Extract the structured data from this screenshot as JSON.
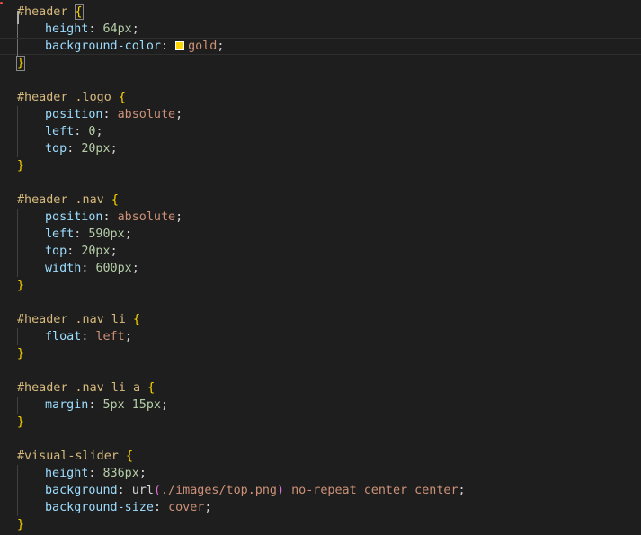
{
  "colors": {
    "background": "#1e1e1e",
    "selector": "#d7ba7d",
    "property": "#9cdcfe",
    "number": "#b5cea8",
    "keyword": "#ce9178",
    "brace": "#ffd700",
    "paren": "#da70d6",
    "swatch_gold": "#ffd700"
  },
  "lines": [
    {
      "tokens": [
        {
          "t": "#header ",
          "c": "sel"
        },
        {
          "t": "{",
          "c": "brace matched"
        }
      ]
    },
    {
      "indent": true,
      "tokens": [
        {
          "t": "height",
          "c": "prop"
        },
        {
          "t": ": ",
          "c": "punct"
        },
        {
          "t": "64px",
          "c": "num"
        },
        {
          "t": ";",
          "c": "punct"
        }
      ]
    },
    {
      "indent": true,
      "current": true,
      "tokens": [
        {
          "t": "background-color",
          "c": "prop"
        },
        {
          "t": ": ",
          "c": "punct"
        },
        {
          "swatch": "#ffd700"
        },
        {
          "t": "gold",
          "c": "kw"
        },
        {
          "t": ";",
          "c": "punct"
        }
      ]
    },
    {
      "tokens": [
        {
          "t": "}",
          "c": "brace matched"
        }
      ]
    },
    {
      "tokens": []
    },
    {
      "tokens": [
        {
          "t": "#header .logo ",
          "c": "sel"
        },
        {
          "t": "{",
          "c": "brace"
        }
      ]
    },
    {
      "indent": true,
      "tokens": [
        {
          "t": "position",
          "c": "prop"
        },
        {
          "t": ": ",
          "c": "punct"
        },
        {
          "t": "absolute",
          "c": "kw"
        },
        {
          "t": ";",
          "c": "punct"
        }
      ]
    },
    {
      "indent": true,
      "tokens": [
        {
          "t": "left",
          "c": "prop"
        },
        {
          "t": ": ",
          "c": "punct"
        },
        {
          "t": "0",
          "c": "num"
        },
        {
          "t": ";",
          "c": "punct"
        }
      ]
    },
    {
      "indent": true,
      "tokens": [
        {
          "t": "top",
          "c": "prop"
        },
        {
          "t": ": ",
          "c": "punct"
        },
        {
          "t": "20px",
          "c": "num"
        },
        {
          "t": ";",
          "c": "punct"
        }
      ]
    },
    {
      "tokens": [
        {
          "t": "}",
          "c": "brace"
        }
      ]
    },
    {
      "tokens": []
    },
    {
      "tokens": [
        {
          "t": "#header .nav ",
          "c": "sel"
        },
        {
          "t": "{",
          "c": "brace"
        }
      ]
    },
    {
      "indent": true,
      "tokens": [
        {
          "t": "position",
          "c": "prop"
        },
        {
          "t": ": ",
          "c": "punct"
        },
        {
          "t": "absolute",
          "c": "kw"
        },
        {
          "t": ";",
          "c": "punct"
        }
      ]
    },
    {
      "indent": true,
      "tokens": [
        {
          "t": "left",
          "c": "prop"
        },
        {
          "t": ": ",
          "c": "punct"
        },
        {
          "t": "590px",
          "c": "num"
        },
        {
          "t": ";",
          "c": "punct"
        }
      ]
    },
    {
      "indent": true,
      "tokens": [
        {
          "t": "top",
          "c": "prop"
        },
        {
          "t": ": ",
          "c": "punct"
        },
        {
          "t": "20px",
          "c": "num"
        },
        {
          "t": ";",
          "c": "punct"
        }
      ]
    },
    {
      "indent": true,
      "tokens": [
        {
          "t": "width",
          "c": "prop"
        },
        {
          "t": ": ",
          "c": "punct"
        },
        {
          "t": "600px",
          "c": "num"
        },
        {
          "t": ";",
          "c": "punct"
        }
      ]
    },
    {
      "tokens": [
        {
          "t": "}",
          "c": "brace"
        }
      ]
    },
    {
      "tokens": []
    },
    {
      "tokens": [
        {
          "t": "#header .nav li ",
          "c": "sel"
        },
        {
          "t": "{",
          "c": "brace"
        }
      ]
    },
    {
      "indent": true,
      "tokens": [
        {
          "t": "float",
          "c": "prop"
        },
        {
          "t": ": ",
          "c": "punct"
        },
        {
          "t": "left",
          "c": "kw"
        },
        {
          "t": ";",
          "c": "punct"
        }
      ]
    },
    {
      "tokens": [
        {
          "t": "}",
          "c": "brace"
        }
      ]
    },
    {
      "tokens": []
    },
    {
      "tokens": [
        {
          "t": "#header .nav li a ",
          "c": "sel"
        },
        {
          "t": "{",
          "c": "brace"
        }
      ]
    },
    {
      "indent": true,
      "tokens": [
        {
          "t": "margin",
          "c": "prop"
        },
        {
          "t": ": ",
          "c": "punct"
        },
        {
          "t": "5px 15px",
          "c": "num"
        },
        {
          "t": ";",
          "c": "punct"
        }
      ]
    },
    {
      "tokens": [
        {
          "t": "}",
          "c": "brace"
        }
      ]
    },
    {
      "tokens": []
    },
    {
      "tokens": [
        {
          "t": "#visual-slider ",
          "c": "sel"
        },
        {
          "t": "{",
          "c": "brace"
        }
      ]
    },
    {
      "indent": true,
      "tokens": [
        {
          "t": "height",
          "c": "prop"
        },
        {
          "t": ": ",
          "c": "punct"
        },
        {
          "t": "836px",
          "c": "num"
        },
        {
          "t": ";",
          "c": "punct"
        }
      ]
    },
    {
      "indent": true,
      "tokens": [
        {
          "t": "background",
          "c": "prop"
        },
        {
          "t": ": ",
          "c": "punct"
        },
        {
          "t": "url",
          "c": "fn"
        },
        {
          "t": "(",
          "c": "paren"
        },
        {
          "t": "./images/top.png",
          "c": "url"
        },
        {
          "t": ")",
          "c": "paren"
        },
        {
          "t": " no-repeat center center",
          "c": "kw"
        },
        {
          "t": ";",
          "c": "punct"
        }
      ]
    },
    {
      "indent": true,
      "tokens": [
        {
          "t": "background-size",
          "c": "prop"
        },
        {
          "t": ": ",
          "c": "punct"
        },
        {
          "t": "cover",
          "c": "kw"
        },
        {
          "t": ";",
          "c": "punct"
        }
      ]
    },
    {
      "tokens": [
        {
          "t": "}",
          "c": "brace"
        }
      ]
    }
  ]
}
